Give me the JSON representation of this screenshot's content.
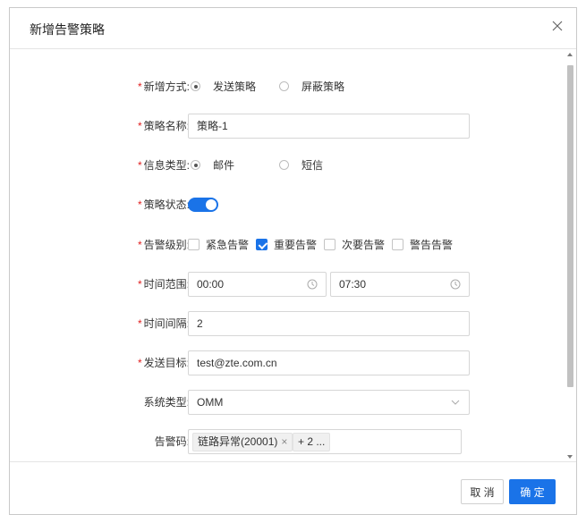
{
  "dialog": {
    "title": "新增告警策略"
  },
  "required_mark": "*",
  "form": {
    "mode": {
      "label": "新增方式:",
      "options": [
        "发送策略",
        "屏蔽策略"
      ],
      "selected": "发送策略"
    },
    "name": {
      "label": "策略名称:",
      "value": "策略-1"
    },
    "info_type": {
      "label": "信息类型:",
      "options": [
        "邮件",
        "短信"
      ],
      "selected": "邮件"
    },
    "status": {
      "label": "策略状态:",
      "on": true
    },
    "level": {
      "label": "告警级别:",
      "options": [
        "紧急告警",
        "重要告警",
        "次要告警",
        "警告告警"
      ],
      "checked": [
        false,
        true,
        false,
        false
      ]
    },
    "time_range": {
      "label": "时间范围:",
      "start": "00:00",
      "end": "07:30"
    },
    "interval": {
      "label": "时间间隔:",
      "value": "2"
    },
    "target": {
      "label": "发送目标:",
      "value": "test@zte.com.cn"
    },
    "system_type": {
      "label": "系统类型:",
      "value": "OMM"
    },
    "alarm_code": {
      "label": "告警码:",
      "tags": [
        "链路异常(20001)"
      ],
      "remove_mark": "×",
      "more": "+ 2 ..."
    }
  },
  "footer": {
    "cancel": "取 消",
    "ok": "确 定"
  },
  "colors": {
    "primary": "#1a73e8",
    "required": "#e02020"
  }
}
